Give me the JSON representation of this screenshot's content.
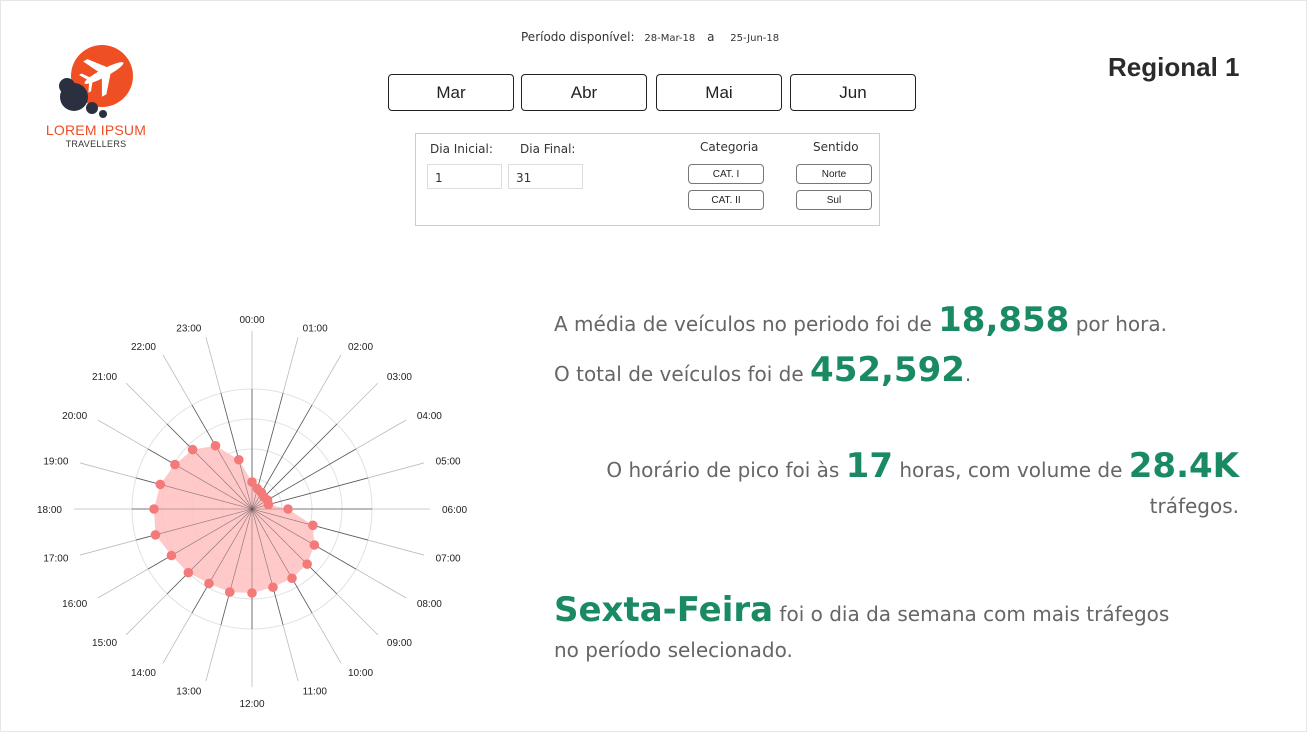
{
  "logo": {
    "brand": "LOREM IPSUM",
    "subtitle": "TRAVELLERS",
    "icon": "airplane-icon"
  },
  "period": {
    "label": "Período disponível:",
    "start": "28-Mar-18",
    "separator": "a",
    "end": "25-Jun-18"
  },
  "months": [
    "Mar",
    "Abr",
    "Mai",
    "Jun"
  ],
  "region_title": "Regional 1",
  "filters": {
    "start_day_label": "Dia Inicial:",
    "start_day_value": "1",
    "end_day_label": "Dia Final:",
    "end_day_value": "31",
    "category_label": "Categoria",
    "categories": [
      "CAT. I",
      "CAT. II"
    ],
    "direction_label": "Sentido",
    "directions": [
      "Norte",
      "Sul"
    ]
  },
  "stats": {
    "avg_prefix": "A média de veículos no periodo foi de",
    "avg_value": "18,858",
    "avg_suffix": "por hora.",
    "total_prefix": "O total de veículos foi de",
    "total_value": "452,592",
    "total_suffix": ".",
    "peak_prefix": "O horário de pico foi às",
    "peak_hour": "17",
    "peak_middle": "horas, com volume de",
    "peak_volume": "28.4K",
    "peak_suffix": "tráfegos.",
    "weekday_value": "Sexta-Feira",
    "weekday_text_1": "foi o dia da semana com mais tráfegos",
    "weekday_text_2": "no período selecionado."
  },
  "colors": {
    "accent": "#1a8a62",
    "brand": "#f04e23",
    "radar_fill": "#ffc0c0",
    "radar_point": "#f47a7a"
  },
  "chart_data": {
    "type": "radar",
    "categories": [
      "00:00",
      "01:00",
      "02:00",
      "03:00",
      "04:00",
      "05:00",
      "06:00",
      "07:00",
      "08:00",
      "09:00",
      "10:00",
      "11:00",
      "12:00",
      "13:00",
      "14:00",
      "15:00",
      "16:00",
      "17:00",
      "18:00",
      "19:00",
      "20:00",
      "21:00",
      "22:00",
      "23:00"
    ],
    "values": [
      0.27,
      0.21,
      0.19,
      0.17,
      0.18,
      0.17,
      0.36,
      0.63,
      0.72,
      0.78,
      0.8,
      0.81,
      0.84,
      0.86,
      0.86,
      0.9,
      0.93,
      1.0,
      0.98,
      0.95,
      0.89,
      0.84,
      0.73,
      0.51
    ],
    "scale": "relative to peak hour volume",
    "max": 1.2,
    "grid_rings": 4
  }
}
